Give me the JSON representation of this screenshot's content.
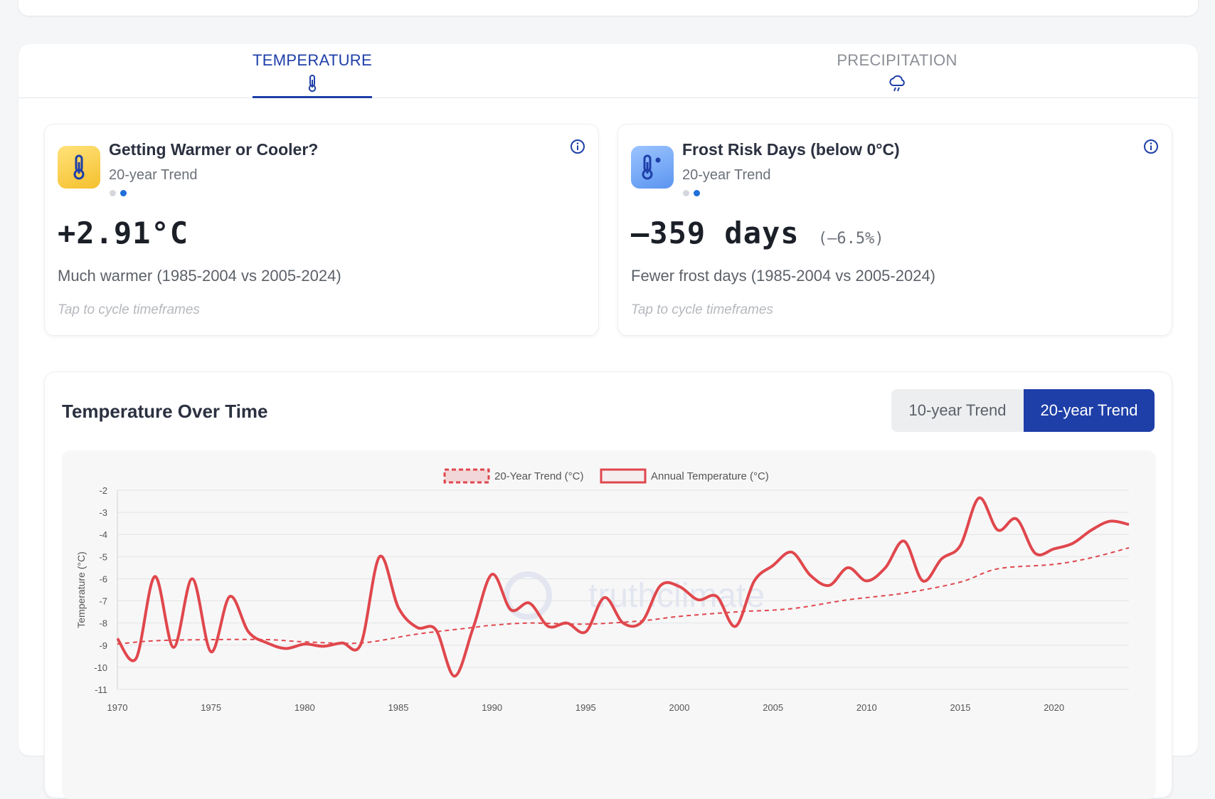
{
  "tabs": [
    {
      "label": "TEMPERATURE",
      "active": true,
      "icon": "thermometer-icon"
    },
    {
      "label": "PRECIPITATION",
      "active": false,
      "icon": "rain-cloud-icon"
    }
  ],
  "cards": {
    "temperature": {
      "title": "Getting Warmer or Cooler?",
      "subtitle": "20-year Trend",
      "value": "+2.91°C",
      "percent": "",
      "description": "Much warmer (1985-2004 vs 2005-2024)",
      "hint": "Tap to cycle timeframes",
      "icon": "thermometer-icon",
      "active_dot": 2
    },
    "frost": {
      "title": "Frost Risk Days (below 0°C)",
      "subtitle": "20-year Trend",
      "value": "–359 days",
      "percent": "(–6.5%)",
      "description": "Fewer frost days (1985-2004 vs 2005-2024)",
      "hint": "Tap to cycle timeframes",
      "icon": "thermometer-snow-icon",
      "active_dot": 2
    }
  },
  "chart_section": {
    "title": "Temperature Over Time",
    "toggle": [
      {
        "label": "10-year Trend",
        "active": false
      },
      {
        "label": "20-year Trend",
        "active": true
      }
    ],
    "watermark": "truthclimate"
  },
  "colors": {
    "accent": "#1e3fa8",
    "series_red": "#e0474c"
  },
  "chart_data": {
    "type": "line",
    "ylabel": "Temperature (°C)",
    "xlabel": "",
    "ylim": [
      -11,
      -2
    ],
    "yticks": [
      -2,
      -3,
      -4,
      -5,
      -6,
      -7,
      -8,
      -9,
      -10,
      -11
    ],
    "xlim": [
      1970,
      2024
    ],
    "xticks": [
      1970,
      1975,
      1980,
      1985,
      1990,
      1995,
      2000,
      2005,
      2010,
      2015,
      2020
    ],
    "legend_position": "top",
    "grid": true,
    "series": [
      {
        "name": "20-Year Trend (°C)",
        "style": "dashed",
        "x": [
          1970,
          1972,
          1975,
          1978,
          1980,
          1983,
          1986,
          1989,
          1990,
          1992,
          1995,
          1998,
          2000,
          2003,
          2006,
          2009,
          2012,
          2015,
          2017,
          2020,
          2022,
          2024
        ],
        "values": [
          -8.95,
          -8.8,
          -8.75,
          -8.75,
          -8.85,
          -8.9,
          -8.5,
          -8.2,
          -8.1,
          -8.0,
          -8.05,
          -7.9,
          -7.7,
          -7.5,
          -7.35,
          -6.95,
          -6.65,
          -6.15,
          -5.55,
          -5.35,
          -5.05,
          -4.6
        ]
      },
      {
        "name": "Annual Temperature (°C)",
        "style": "solid",
        "x": [
          1970,
          1971,
          1972,
          1973,
          1974,
          1975,
          1976,
          1977,
          1978,
          1979,
          1980,
          1981,
          1982,
          1983,
          1984,
          1985,
          1986,
          1987,
          1988,
          1989,
          1990,
          1991,
          1992,
          1993,
          1994,
          1995,
          1996,
          1997,
          1998,
          1999,
          2000,
          2001,
          2002,
          2003,
          2004,
          2005,
          2006,
          2007,
          2008,
          2009,
          2010,
          2011,
          2012,
          2013,
          2014,
          2015,
          2016,
          2017,
          2018,
          2019,
          2020,
          2021,
          2022,
          2023,
          2024
        ],
        "values": [
          -8.7,
          -9.6,
          -5.9,
          -9.1,
          -6.0,
          -9.3,
          -6.8,
          -8.4,
          -8.9,
          -9.15,
          -8.95,
          -9.05,
          -8.9,
          -8.95,
          -5.0,
          -7.3,
          -8.2,
          -8.3,
          -10.4,
          -8.2,
          -5.8,
          -7.4,
          -7.1,
          -8.15,
          -8.0,
          -8.4,
          -6.85,
          -8.0,
          -7.95,
          -6.3,
          -6.35,
          -6.95,
          -6.8,
          -8.15,
          -6.1,
          -5.4,
          -4.8,
          -5.85,
          -6.3,
          -5.5,
          -6.1,
          -5.5,
          -4.3,
          -6.1,
          -5.1,
          -4.5,
          -2.35,
          -3.8,
          -3.3,
          -4.85,
          -4.65,
          -4.4,
          -3.8,
          -3.4,
          -3.55
        ]
      }
    ]
  }
}
